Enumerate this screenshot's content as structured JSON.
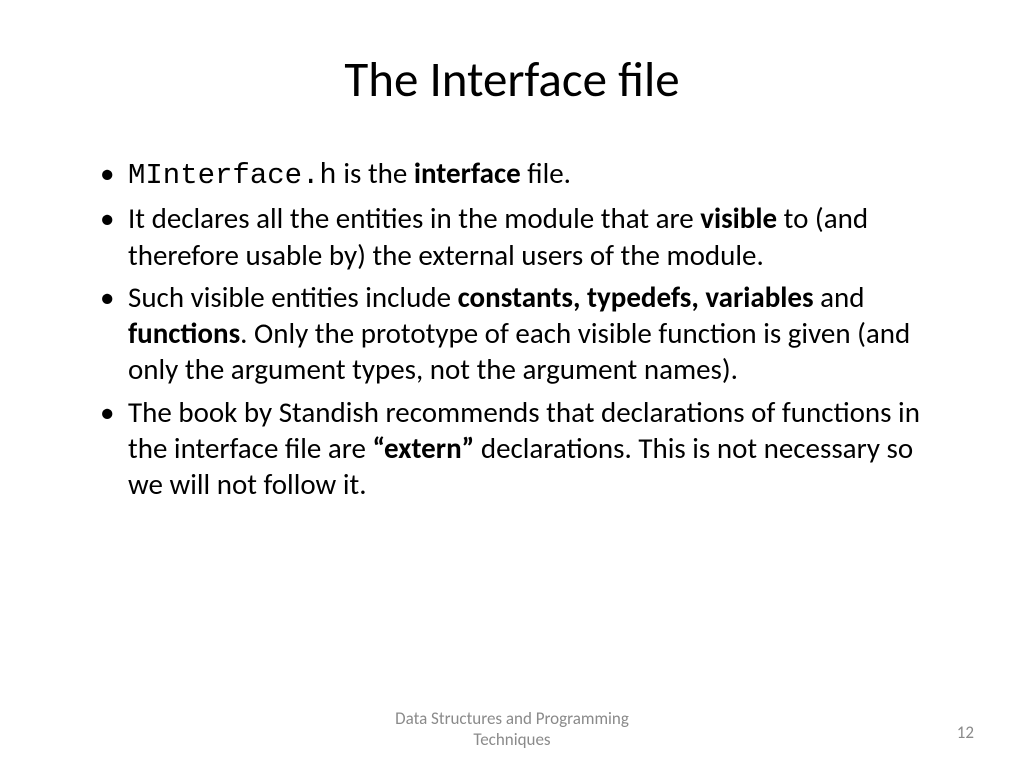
{
  "slide": {
    "title": "The Interface file",
    "bullets": {
      "b1_mono": "MInterface.h",
      "b1_text1": " is the ",
      "b1_bold1": "interface",
      "b1_text2": " file.",
      "b2_text1": "It declares all the entities in the module that are ",
      "b2_bold1": "visible",
      "b2_text2": " to (and therefore usable by) the external users of the module.",
      "b3_text1": "Such visible entities include ",
      "b3_bold1": "constants, typedefs, variables",
      "b3_text2": " and ",
      "b3_bold2": "functions",
      "b3_text3": ". Only the prototype of each visible function is given (and only the argument types, not the argument names).",
      "b4_text1": "The book by Standish recommends that declarations of functions in the interface file are ",
      "b4_bold1": "“extern”",
      "b4_text2": " declarations. This is not necessary so we will not follow it."
    }
  },
  "footer": {
    "line1": "Data Structures and Programming",
    "line2": "Techniques",
    "pageNumber": "12"
  }
}
